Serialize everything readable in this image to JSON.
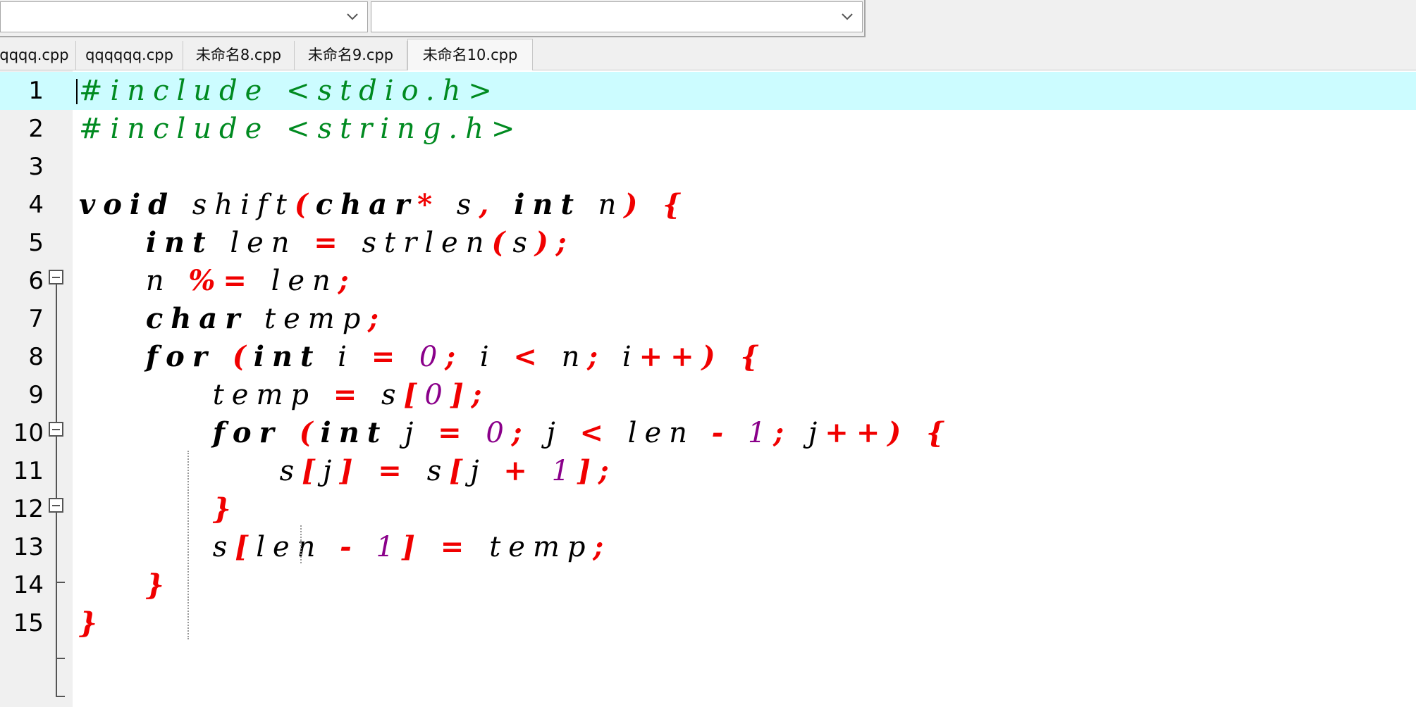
{
  "toolbar": {
    "combo1": {
      "value": ""
    },
    "combo2": {
      "value": ""
    }
  },
  "tabs": [
    {
      "label": "qqqq.cpp"
    },
    {
      "label": "qqqqqq.cpp"
    },
    {
      "label": "未命名8.cpp"
    },
    {
      "label": "未命名9.cpp"
    },
    {
      "label": "未命名10.cpp"
    }
  ],
  "active_tab": "未命名10.cpp",
  "editor": {
    "current_line": 1,
    "lines": [
      {
        "num": "1",
        "tokens": [
          {
            "t": "#include <stdio.h>",
            "k": "pre"
          }
        ]
      },
      {
        "num": "2",
        "tokens": [
          {
            "t": "#include <string.h>",
            "k": "pre"
          }
        ]
      },
      {
        "num": "3",
        "tokens": []
      },
      {
        "num": "4",
        "tokens": [
          {
            "t": "void",
            "k": "kw"
          },
          {
            "t": " shift",
            "k": "id"
          },
          {
            "t": "(",
            "k": "op"
          },
          {
            "t": "char",
            "k": "kw"
          },
          {
            "t": "*",
            "k": "op"
          },
          {
            "t": " s",
            "k": "id"
          },
          {
            "t": ", ",
            "k": "op"
          },
          {
            "t": "int",
            "k": "kw"
          },
          {
            "t": " n",
            "k": "id"
          },
          {
            "t": ") {",
            "k": "op"
          }
        ]
      },
      {
        "num": "5",
        "tokens": [
          {
            "t": "    ",
            "k": "id"
          },
          {
            "t": "int",
            "k": "kw"
          },
          {
            "t": " len ",
            "k": "id"
          },
          {
            "t": "=",
            "k": "op"
          },
          {
            "t": " strlen",
            "k": "id"
          },
          {
            "t": "(",
            "k": "op"
          },
          {
            "t": "s",
            "k": "id"
          },
          {
            "t": ");",
            "k": "op"
          }
        ]
      },
      {
        "num": "6",
        "tokens": [
          {
            "t": "    n ",
            "k": "id"
          },
          {
            "t": "%=",
            "k": "op"
          },
          {
            "t": " len",
            "k": "id"
          },
          {
            "t": ";",
            "k": "op"
          }
        ]
      },
      {
        "num": "7",
        "tokens": [
          {
            "t": "    ",
            "k": "id"
          },
          {
            "t": "char",
            "k": "kw"
          },
          {
            "t": " temp",
            "k": "id"
          },
          {
            "t": ";",
            "k": "op"
          }
        ]
      },
      {
        "num": "8",
        "tokens": [
          {
            "t": "    ",
            "k": "id"
          },
          {
            "t": "for",
            "k": "kw"
          },
          {
            "t": " (",
            "k": "op"
          },
          {
            "t": "int",
            "k": "kw"
          },
          {
            "t": " i ",
            "k": "id"
          },
          {
            "t": "=",
            "k": "op"
          },
          {
            "t": " 0",
            "k": "num"
          },
          {
            "t": ";",
            "k": "op"
          },
          {
            "t": " i ",
            "k": "id"
          },
          {
            "t": "<",
            "k": "op"
          },
          {
            "t": " n",
            "k": "id"
          },
          {
            "t": ";",
            "k": "op"
          },
          {
            "t": " i",
            "k": "id"
          },
          {
            "t": "++) {",
            "k": "op"
          }
        ]
      },
      {
        "num": "9",
        "tokens": [
          {
            "t": "        temp ",
            "k": "id"
          },
          {
            "t": "=",
            "k": "op"
          },
          {
            "t": " s",
            "k": "id"
          },
          {
            "t": "[",
            "k": "op"
          },
          {
            "t": "0",
            "k": "num"
          },
          {
            "t": "];",
            "k": "op"
          }
        ]
      },
      {
        "num": "10",
        "tokens": [
          {
            "t": "        ",
            "k": "id"
          },
          {
            "t": "for",
            "k": "kw"
          },
          {
            "t": " (",
            "k": "op"
          },
          {
            "t": "int",
            "k": "kw"
          },
          {
            "t": " j ",
            "k": "id"
          },
          {
            "t": "=",
            "k": "op"
          },
          {
            "t": " 0",
            "k": "num"
          },
          {
            "t": ";",
            "k": "op"
          },
          {
            "t": " j ",
            "k": "id"
          },
          {
            "t": "<",
            "k": "op"
          },
          {
            "t": " len ",
            "k": "id"
          },
          {
            "t": "-",
            "k": "op"
          },
          {
            "t": " 1",
            "k": "num"
          },
          {
            "t": ";",
            "k": "op"
          },
          {
            "t": " j",
            "k": "id"
          },
          {
            "t": "++) {",
            "k": "op"
          }
        ]
      },
      {
        "num": "11",
        "tokens": [
          {
            "t": "            s",
            "k": "id"
          },
          {
            "t": "[",
            "k": "op"
          },
          {
            "t": "j",
            "k": "id"
          },
          {
            "t": "] = ",
            "k": "op"
          },
          {
            "t": "s",
            "k": "id"
          },
          {
            "t": "[",
            "k": "op"
          },
          {
            "t": "j ",
            "k": "id"
          },
          {
            "t": "+",
            "k": "op"
          },
          {
            "t": " 1",
            "k": "num"
          },
          {
            "t": "];",
            "k": "op"
          }
        ]
      },
      {
        "num": "12",
        "tokens": [
          {
            "t": "        ",
            "k": "id"
          },
          {
            "t": "}",
            "k": "op"
          }
        ]
      },
      {
        "num": "13",
        "tokens": [
          {
            "t": "        s",
            "k": "id"
          },
          {
            "t": "[",
            "k": "op"
          },
          {
            "t": "len ",
            "k": "id"
          },
          {
            "t": "-",
            "k": "op"
          },
          {
            "t": " 1",
            "k": "num"
          },
          {
            "t": "] = ",
            "k": "op"
          },
          {
            "t": "temp",
            "k": "id"
          },
          {
            "t": ";",
            "k": "op"
          }
        ]
      },
      {
        "num": "14",
        "tokens": [
          {
            "t": "    ",
            "k": "id"
          },
          {
            "t": "}",
            "k": "op"
          }
        ]
      },
      {
        "num": "15",
        "tokens": [
          {
            "t": "}",
            "k": "op"
          }
        ]
      }
    ]
  },
  "colors": {
    "preprocessor": "#008a20",
    "keyword": "#000000",
    "operator": "#f00000",
    "number": "#8a008a",
    "current_line_bg": "#ccfcff"
  }
}
